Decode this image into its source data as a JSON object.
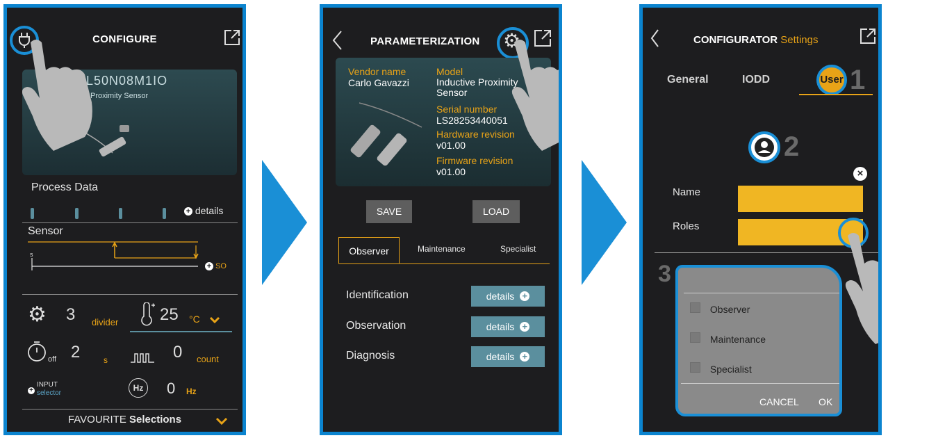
{
  "colors": {
    "accent": "#0b84cf",
    "orange": "#e8a317",
    "button_teal": "#5b8f9e",
    "yellow": "#f0b623",
    "panel": "#1d1d1f"
  },
  "screen1": {
    "title": "CONFIGURE",
    "device_code": "I2L50N08M1IO",
    "device_desc": "Proximity Sensor",
    "process_data": "Process Data",
    "details": "details",
    "sensor": "Sensor",
    "s_label": "s",
    "so_label": "SO",
    "divider_value": "3",
    "divider_label": "divider",
    "temp_value": "25",
    "temp_unit": "°C",
    "timer_sub": "off",
    "timer_value": "2",
    "timer_unit": "s",
    "count_value": "0",
    "count_label": "count",
    "input_label": "INPUT",
    "selector_label": "selector",
    "hz_value": "0",
    "hz_unit": "Hz",
    "favourite": "FAVOURITE",
    "selections": "Selections"
  },
  "screen2": {
    "title": "PARAMETERIZATION",
    "vendor_label": "Vendor name",
    "vendor_value": "Carlo Gavazzi",
    "model_label": "Model",
    "model_value": "Inductive Proximity Sensor",
    "serial_label": "Serial number",
    "serial_value": "LS28253440051",
    "hw_label": "Hardware revision",
    "hw_value": "v01.00",
    "fw_label": "Firmware revision",
    "fw_value": "v01.00",
    "save": "SAVE",
    "load": "LOAD",
    "tabs": [
      "Observer",
      "Maintenance",
      "Specialist"
    ],
    "rows": [
      {
        "label": "Identification",
        "button": "details"
      },
      {
        "label": "Observation",
        "button": "details"
      },
      {
        "label": "Diagnosis",
        "button": "details"
      }
    ]
  },
  "screen3": {
    "title": "CONFIGURATOR",
    "title_sub": "Settings",
    "tabs": [
      "General",
      "IODD",
      "User"
    ],
    "step1": "1",
    "step2": "2",
    "step3": "3",
    "name_label": "Name",
    "roles_label": "Roles",
    "options": [
      "Observer",
      "Maintenance",
      "Specialist"
    ],
    "cancel": "CANCEL",
    "ok": "OK"
  }
}
